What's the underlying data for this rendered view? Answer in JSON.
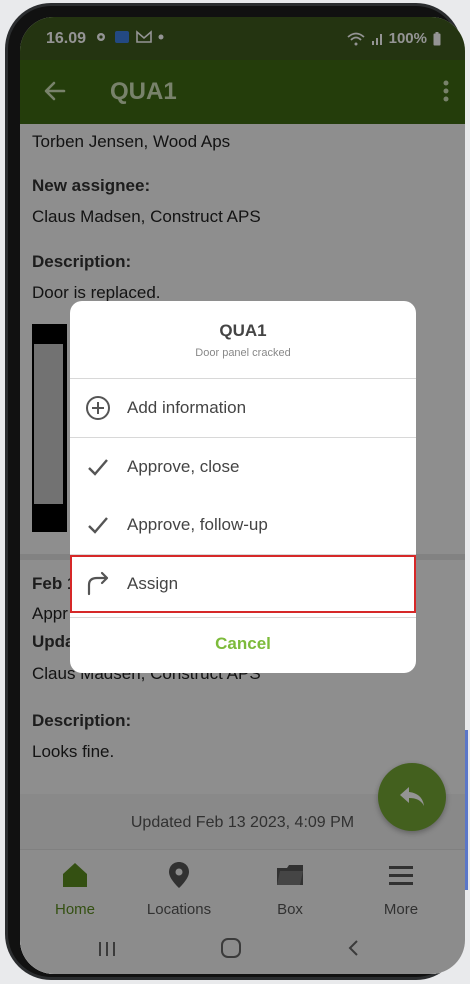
{
  "status_bar": {
    "time": "16.09",
    "battery": "100%"
  },
  "app_bar": {
    "title": "QUA1"
  },
  "content": {
    "top_line": "Torben Jensen, Wood Aps",
    "new_assignee_label": "New assignee:",
    "new_assignee_value": "Claus Madsen, Construct APS",
    "description_label": "Description:",
    "description_value": "Door is replaced.",
    "entry2_date_partial": "Feb 1",
    "entry2_status_partial": "Appr",
    "entry2_updated_partial": "Upda",
    "entry2_assignee_value": "Claus Madsen, Construct APS",
    "description2_label": "Description:",
    "description2_value": "Looks fine.",
    "updated_text": "Updated Feb 13 2023, 4:09 PM"
  },
  "bottom_nav": {
    "items": [
      {
        "label": "Home",
        "icon": "home-icon",
        "active": true
      },
      {
        "label": "Locations",
        "icon": "location-pin-icon",
        "active": false
      },
      {
        "label": "Box",
        "icon": "folder-icon",
        "active": false
      },
      {
        "label": "More",
        "icon": "menu-icon",
        "active": false
      }
    ]
  },
  "dialog": {
    "title": "QUA1",
    "subtitle": "Door panel cracked",
    "options": [
      {
        "label": "Add information",
        "icon": "plus-circle-icon"
      },
      {
        "label": "Approve, close",
        "icon": "check-icon"
      },
      {
        "label": "Approve, follow-up",
        "icon": "check-icon"
      },
      {
        "label": "Assign",
        "icon": "forward-arrow-icon"
      }
    ],
    "cancel_label": "Cancel"
  },
  "colors": {
    "app_bar": "#3e6a14",
    "accent_green": "#7dbb3b",
    "highlight_red": "#d62828"
  }
}
